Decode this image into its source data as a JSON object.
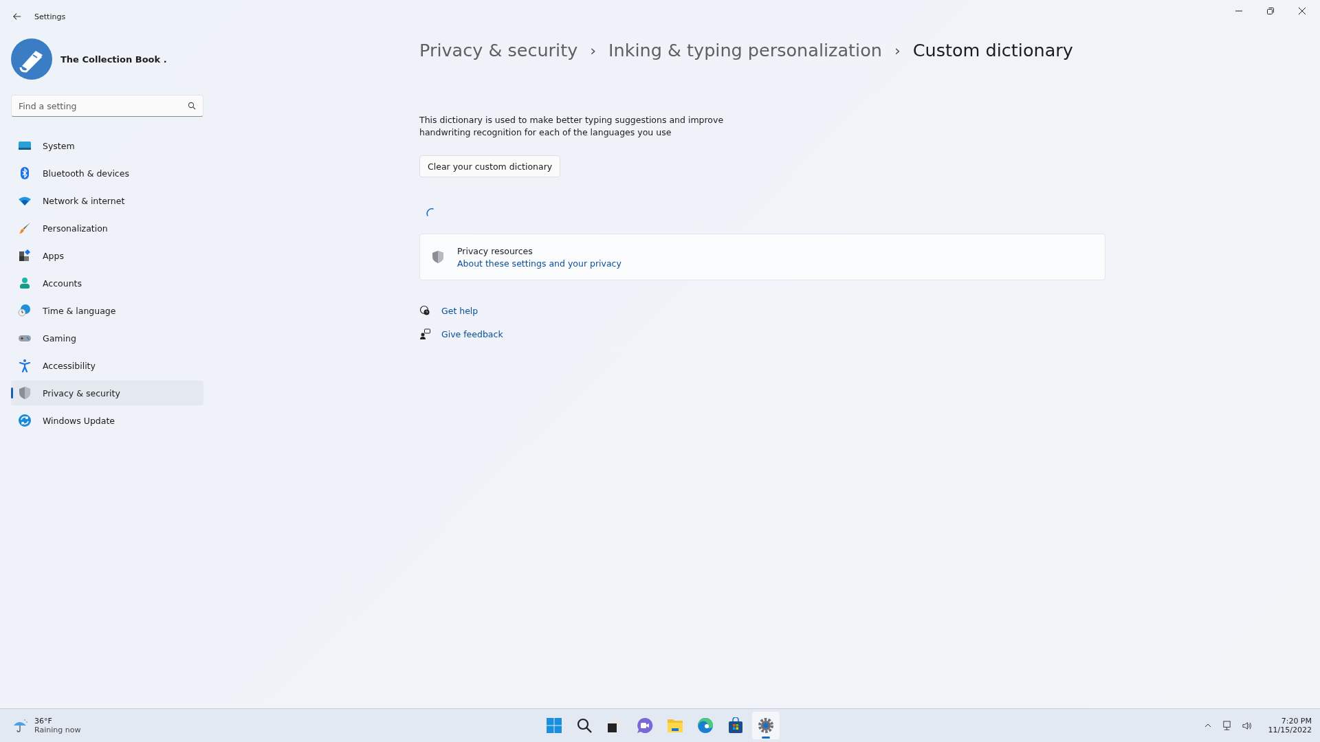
{
  "window": {
    "title": "Settings"
  },
  "account": {
    "name": "The Collection Book ."
  },
  "search": {
    "placeholder": "Find a setting"
  },
  "sidebar": {
    "items": [
      {
        "label": "System",
        "kind": "system",
        "selected": false
      },
      {
        "label": "Bluetooth & devices",
        "kind": "bluetooth",
        "selected": false
      },
      {
        "label": "Network & internet",
        "kind": "network",
        "selected": false
      },
      {
        "label": "Personalization",
        "kind": "brush",
        "selected": false
      },
      {
        "label": "Apps",
        "kind": "apps",
        "selected": false
      },
      {
        "label": "Accounts",
        "kind": "accounts",
        "selected": false
      },
      {
        "label": "Time & language",
        "kind": "time",
        "selected": false
      },
      {
        "label": "Gaming",
        "kind": "gaming",
        "selected": false
      },
      {
        "label": "Accessibility",
        "kind": "accessibility",
        "selected": false
      },
      {
        "label": "Privacy & security",
        "kind": "privacy",
        "selected": true
      },
      {
        "label": "Windows Update",
        "kind": "update",
        "selected": false
      }
    ]
  },
  "breadcrumb": [
    "Privacy & security",
    "Inking & typing personalization",
    "Custom dictionary"
  ],
  "breadcrumb_separators": [
    "›",
    "›"
  ],
  "description": "This dictionary is used to make better typing suggestions and improve handwriting recognition for each of the languages you use",
  "clear_button": "Clear your custom dictionary",
  "privacy_resources": {
    "title": "Privacy resources",
    "link": "About these settings and your privacy"
  },
  "help_links": [
    {
      "label": "Get help",
      "kind": "help"
    },
    {
      "label": "Give feedback",
      "kind": "feedback"
    }
  ],
  "taskbar": {
    "weather": {
      "temperature": "36°F",
      "condition": "Raining now"
    },
    "apps": [
      {
        "kind": "start",
        "active": false
      },
      {
        "kind": "search",
        "active": false
      },
      {
        "kind": "taskview",
        "active": false
      },
      {
        "kind": "chat",
        "active": false
      },
      {
        "kind": "explorer",
        "active": false
      },
      {
        "kind": "edge",
        "active": false
      },
      {
        "kind": "store",
        "active": false
      },
      {
        "kind": "settings",
        "active": true
      }
    ],
    "time": "7:20 PM",
    "date": "11/15/2022"
  }
}
